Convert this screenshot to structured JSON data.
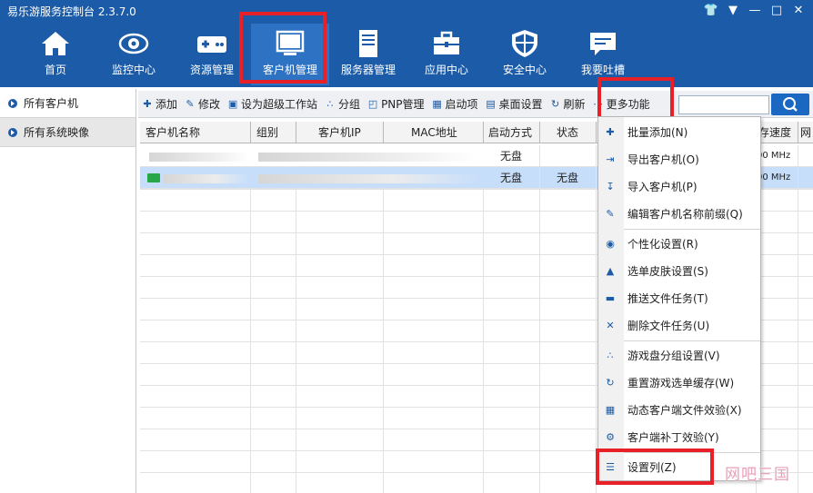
{
  "window": {
    "title": "易乐游服务控制台 2.3.7.0"
  },
  "nav": [
    {
      "label": "首页",
      "icon": "home-icon"
    },
    {
      "label": "监控中心",
      "icon": "eye-icon"
    },
    {
      "label": "资源管理",
      "icon": "gamepad-icon"
    },
    {
      "label": "客户机管理",
      "icon": "monitor-icon"
    },
    {
      "label": "服务器管理",
      "icon": "server-icon"
    },
    {
      "label": "应用中心",
      "icon": "toolbox-icon"
    },
    {
      "label": "安全中心",
      "icon": "shield-icon"
    },
    {
      "label": "我要吐槽",
      "icon": "chat-icon"
    }
  ],
  "sidebar": {
    "items": [
      {
        "label": "所有客户机"
      },
      {
        "label": "所有系统映像"
      }
    ]
  },
  "toolbar": {
    "items": [
      {
        "label": "添加",
        "icon": "plus-icon"
      },
      {
        "label": "修改",
        "icon": "edit-icon"
      },
      {
        "label": "设为超级工作站",
        "icon": "workstation-icon"
      },
      {
        "label": "分组",
        "icon": "group-icon"
      },
      {
        "label": "PNP管理",
        "icon": "pnp-icon"
      },
      {
        "label": "启动项",
        "icon": "startup-icon"
      },
      {
        "label": "桌面设置",
        "icon": "desktop-icon"
      },
      {
        "label": "刷新",
        "icon": "refresh-icon"
      },
      {
        "label": "更多功能",
        "icon": "more-icon"
      }
    ],
    "search_placeholder": ""
  },
  "table": {
    "columns": [
      "客户机名称",
      "组别",
      "客户机IP",
      "MAC地址",
      "启动方式",
      "状态",
      "存速度",
      "网"
    ],
    "rows": [
      {
        "boot": "无盘",
        "status": "",
        "speed": "00 MHz"
      },
      {
        "boot": "无盘",
        "status": "无盘",
        "speed": "00 MHz"
      }
    ]
  },
  "menu": {
    "items": [
      {
        "label": "批量添加(N)",
        "icon": "batch-add-icon"
      },
      {
        "label": "导出客户机(O)",
        "icon": "export-icon"
      },
      {
        "label": "导入客户机(P)",
        "icon": "import-icon"
      },
      {
        "label": "编辑客户机名称前缀(Q)",
        "icon": "edit-prefix-icon"
      },
      {
        "label": "个性化设置(R)",
        "icon": "personalize-icon"
      },
      {
        "label": "选单皮肤设置(S)",
        "icon": "skin-icon"
      },
      {
        "label": "推送文件任务(T)",
        "icon": "folder-icon"
      },
      {
        "label": "删除文件任务(U)",
        "icon": "delete-icon"
      },
      {
        "label": "游戏盘分组设置(V)",
        "icon": "game-disk-icon"
      },
      {
        "label": "重置游戏选单缓存(W)",
        "icon": "reset-icon"
      },
      {
        "label": "动态客户端文件效验(X)",
        "icon": "verify-icon"
      },
      {
        "label": "客户端补丁效验(Y)",
        "icon": "patch-icon"
      },
      {
        "label": "设置列(Z)",
        "icon": "columns-icon"
      }
    ]
  },
  "watermark": "网吧三国",
  "colors": {
    "brand": "#1b5ba8",
    "highlight": "#e82128",
    "selected_row": "#c7defb"
  }
}
